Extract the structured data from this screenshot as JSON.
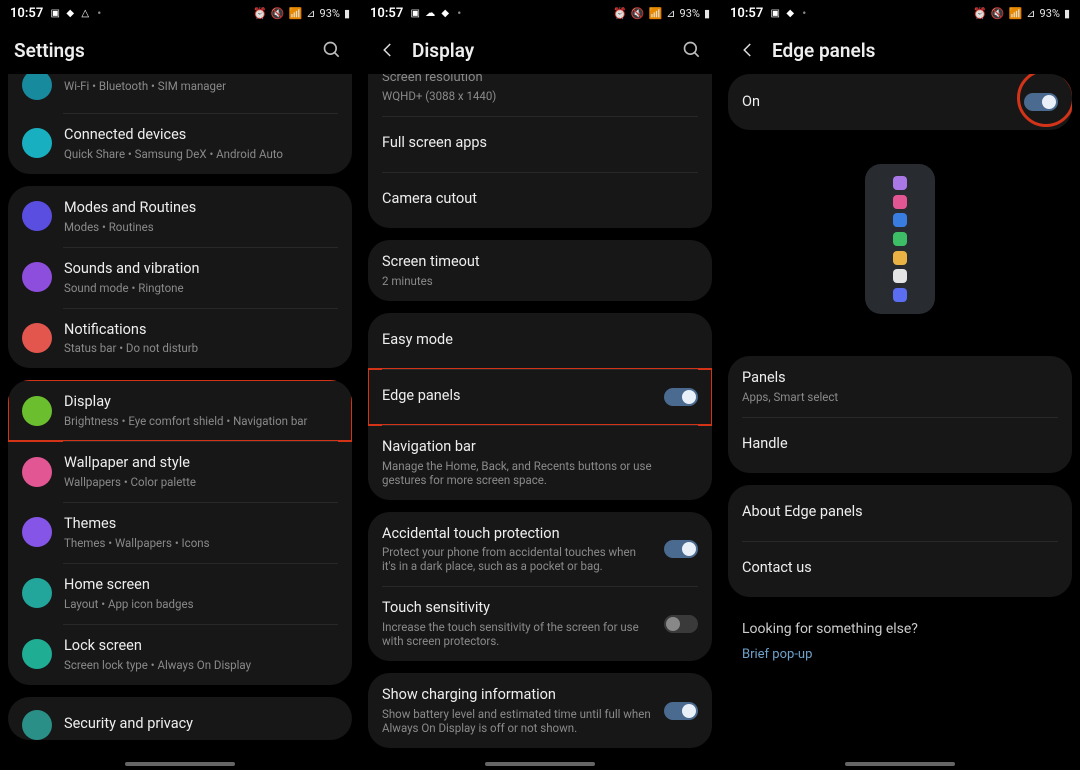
{
  "statusbar": {
    "time": "10:57",
    "battery": "93%",
    "alarm": "⏰",
    "mute": "🔇",
    "wifi": "📶",
    "signal": "▮"
  },
  "screen1": {
    "header": {
      "title": "Settings"
    },
    "items": [
      {
        "label": "",
        "sub": "Wi-Fi • Bluetooth • SIM manager"
      },
      {
        "label": "Connected devices",
        "sub": "Quick Share • Samsung DeX • Android Auto"
      },
      {
        "label": "Modes and Routines",
        "sub": "Modes • Routines"
      },
      {
        "label": "Sounds and vibration",
        "sub": "Sound mode • Ringtone"
      },
      {
        "label": "Notifications",
        "sub": "Status bar • Do not disturb"
      },
      {
        "label": "Display",
        "sub": "Brightness • Eye comfort shield • Navigation bar"
      },
      {
        "label": "Wallpaper and style",
        "sub": "Wallpapers • Color palette"
      },
      {
        "label": "Themes",
        "sub": "Themes • Wallpapers • Icons"
      },
      {
        "label": "Home screen",
        "sub": "Layout • App icon badges"
      },
      {
        "label": "Lock screen",
        "sub": "Screen lock type • Always On Display"
      },
      {
        "label": "Security and privacy",
        "sub": ""
      }
    ]
  },
  "screen2": {
    "header": {
      "title": "Display"
    },
    "items": [
      {
        "label": "Screen resolution",
        "sub": "WQHD+ (3088 x 1440)"
      },
      {
        "label": "Full screen apps"
      },
      {
        "label": "Camera cutout"
      },
      {
        "label": "Screen timeout",
        "sub": "2 minutes"
      },
      {
        "label": "Easy mode"
      },
      {
        "label": "Edge panels",
        "toggle": true
      },
      {
        "label": "Navigation bar",
        "sub": "Manage the Home, Back, and Recents buttons or use gestures for more screen space."
      },
      {
        "label": "Accidental touch protection",
        "sub": "Protect your phone from accidental touches when it's in a dark place, such as a pocket or bag.",
        "toggle": true
      },
      {
        "label": "Touch sensitivity",
        "sub": "Increase the touch sensitivity of the screen for use with screen protectors.",
        "toggle": false
      },
      {
        "label": "Show charging information",
        "sub": "Show battery level and estimated time until full when Always On Display is off or not shown.",
        "toggle": true
      }
    ]
  },
  "screen3": {
    "header": {
      "title": "Edge panels"
    },
    "master": {
      "label": "On",
      "toggle": true
    },
    "panels": {
      "label": "Panels",
      "sub": "Apps, Smart select"
    },
    "handle": {
      "label": "Handle"
    },
    "about": {
      "label": "About Edge panels"
    },
    "contact": {
      "label": "Contact us"
    },
    "looking": {
      "label": "Looking for something else?"
    },
    "brief": {
      "label": "Brief pop-up"
    },
    "dotColors": [
      "#a977e6",
      "#e25693",
      "#3a7de0",
      "#3dbd66",
      "#eab244",
      "#e4e4e4",
      "#5b6df0"
    ]
  }
}
